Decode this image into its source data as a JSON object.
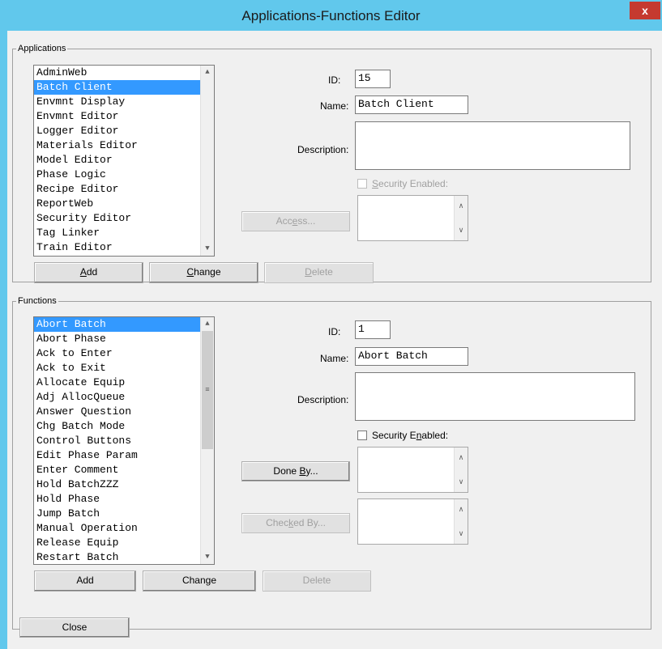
{
  "window": {
    "title": "Applications-Functions Editor",
    "close_glyph": "x"
  },
  "applications": {
    "legend": "Applications",
    "items": [
      "AdminWeb",
      "Batch Client",
      "Envmnt Display",
      "Envmnt Editor",
      "Logger Editor",
      "Materials Editor",
      "Model Editor",
      "Phase Logic",
      "Recipe Editor",
      "ReportWeb",
      "Security Editor",
      "Tag Linker",
      "Train Editor"
    ],
    "selected_index": 1,
    "id_label": "ID:",
    "id_value": "15",
    "name_label": "Name:",
    "name_value": "Batch Client",
    "description_label": "Description:",
    "description_value": "",
    "security_label_pre": "",
    "security_label_u": "S",
    "security_label_post": "ecurity Enabled:",
    "access_pre": "Acc",
    "access_u": "e",
    "access_post": "ss...",
    "add_u": "A",
    "add_post": "dd",
    "change_u": "C",
    "change_post": "hange",
    "delete_u": "D",
    "delete_post": "elete"
  },
  "functions": {
    "legend": "Functions",
    "items": [
      "Abort Batch",
      "Abort Phase",
      "Ack to Enter",
      "Ack to Exit",
      "Allocate Equip",
      "Adj AllocQueue",
      "Answer Question",
      "Chg Batch Mode",
      "Control Buttons",
      "Edit Phase Param",
      "Enter Comment",
      "Hold BatchZZZ",
      "Hold Phase",
      "Jump Batch",
      "Manual Operation",
      "Release Equip",
      "Restart Batch"
    ],
    "selected_index": 0,
    "id_label": "ID:",
    "id_value": "1",
    "name_label": "Name:",
    "name_value": "Abort Batch",
    "description_label": "Description:",
    "description_value": "",
    "security_label_pre": "Security E",
    "security_label_u": "n",
    "security_label_post": "abled:",
    "doneby_pre": "Done ",
    "doneby_u": "B",
    "doneby_post": "y...",
    "checkedby_pre": "Chec",
    "checkedby_u": "k",
    "checkedby_post": "ed By...",
    "add_label": "Add",
    "change_label": "Change",
    "delete_label": "Delete"
  },
  "footer": {
    "close_label": "Close"
  },
  "icons": {
    "scroll_up": "up-arrow-icon",
    "scroll_down": "down-arrow-icon",
    "grip": "grip-icon"
  },
  "colors": {
    "titlebar": "#61c8ec",
    "selection": "#3399ff",
    "close_button": "#c53a2f"
  }
}
